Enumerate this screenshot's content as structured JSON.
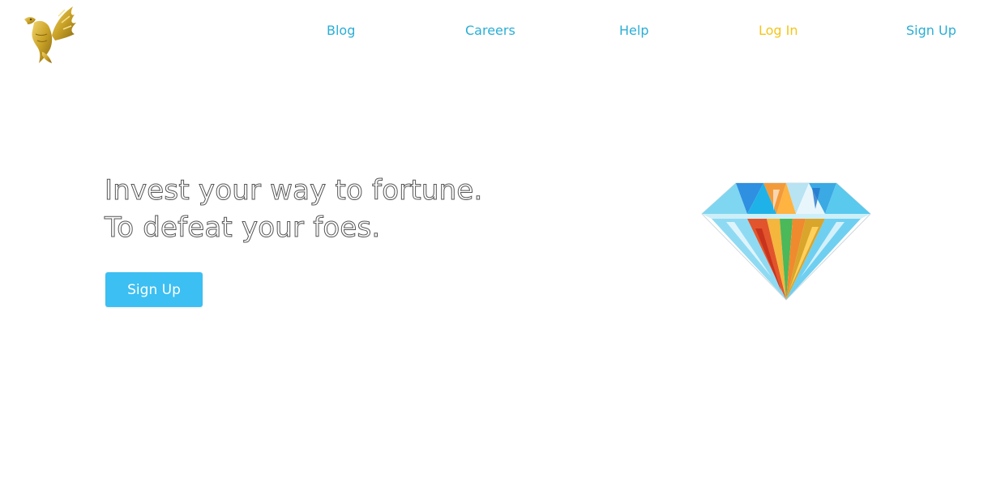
{
  "nav": {
    "items": [
      {
        "label": "Blog"
      },
      {
        "label": "Careers"
      },
      {
        "label": "Help"
      },
      {
        "label": "Log In"
      },
      {
        "label": "Sign Up"
      }
    ]
  },
  "hero": {
    "line1": "Invest your way to fortune.",
    "line2": "To defeat your foes.",
    "cta_label": "Sign Up"
  },
  "icons": {
    "logo": "eagle-logo-icon",
    "illustration": "diamond-icon"
  },
  "colors": {
    "nav_link": "#2aaed6",
    "nav_login": "#f4c51a",
    "cta_background": "#3cbff2",
    "logo_gold": "#c9a227"
  }
}
